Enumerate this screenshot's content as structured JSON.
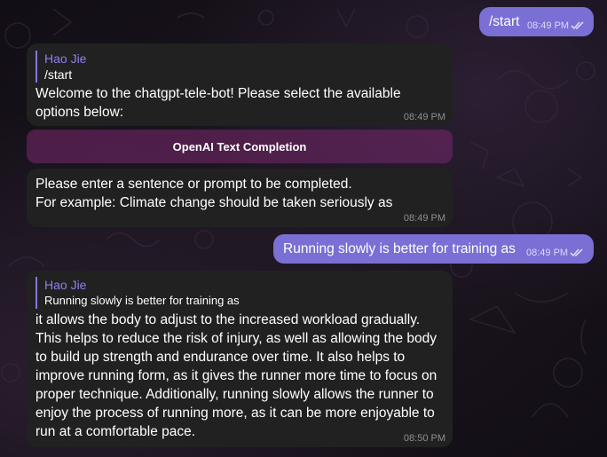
{
  "messages": [
    {
      "id": "m1",
      "direction": "outgoing",
      "text": "/start",
      "time": "08:49 PM"
    },
    {
      "id": "m2",
      "direction": "incoming",
      "reply_to": {
        "name": "Hao Jie",
        "text": "/start"
      },
      "text": "Welcome to the chatgpt-tele-bot! Please select the available options below:",
      "time": "08:49 PM"
    },
    {
      "id": "m3",
      "direction": "incoming",
      "lines": [
        "Please enter a sentence or prompt to be completed.",
        "For example: Climate change should be taken seriously as"
      ],
      "time": "08:49 PM"
    },
    {
      "id": "m4",
      "direction": "outgoing",
      "text": "Running slowly is better for training as",
      "time": "08:49 PM"
    },
    {
      "id": "m5",
      "direction": "incoming",
      "reply_to": {
        "name": "Hao Jie",
        "text": "Running slowly is better for training as"
      },
      "text": "it allows the body to adjust to the increased workload gradually. This helps to reduce the risk of injury, as well as allowing the body to build up strength and endurance over time. It also helps to improve running form, as it gives the runner more time to focus on proper technique. Additionally, running slowly allows the runner to enjoy the process of running more, as it can be more enjoyable to run at a comfortable pace.",
      "time": "08:50 PM"
    }
  ],
  "inline_keyboard": {
    "button_label": "OpenAI Text Completion"
  },
  "colors": {
    "outgoing_bubble": "#7a6fd4",
    "incoming_bubble": "#212121",
    "reply_accent": "#8774e1"
  }
}
